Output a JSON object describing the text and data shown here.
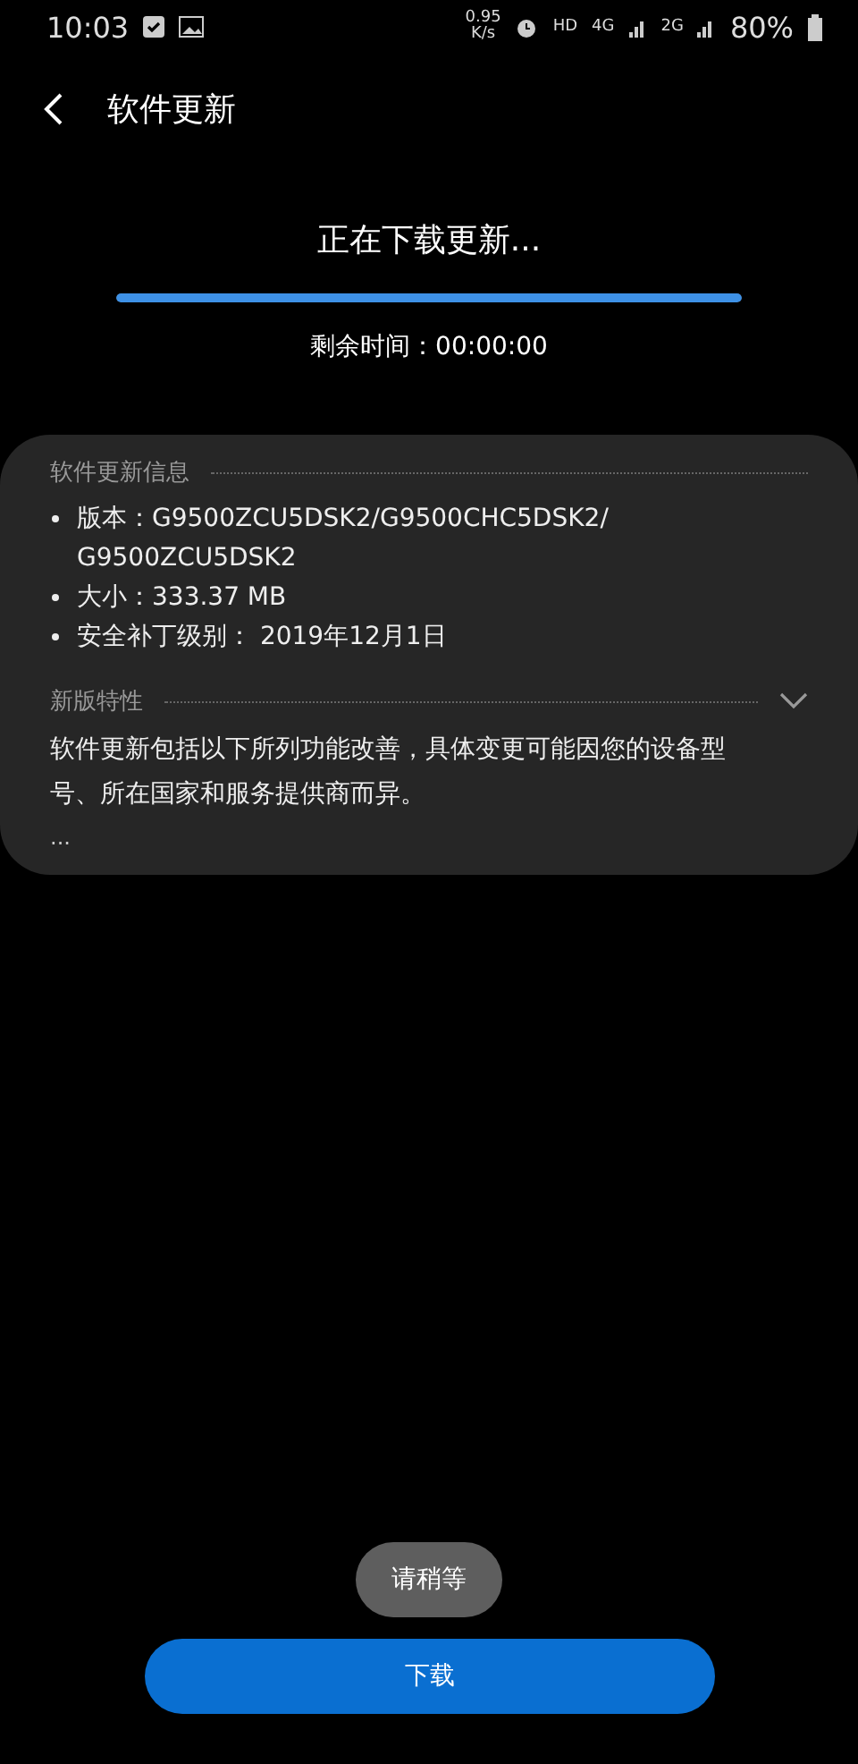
{
  "status_bar": {
    "time": "10:03",
    "speed": "0.95",
    "speed_unit": "K/s",
    "hd": "HD",
    "network": "4G",
    "network2": "2G",
    "battery": "80%"
  },
  "header": {
    "title": "软件更新"
  },
  "download": {
    "title": "正在下载更新...",
    "level": 1,
    "remaining": "剩余时间：00:00:00"
  },
  "info": {
    "heading": "软件更新信息",
    "items": [
      "版本：G9500ZCU5DSK2/G9500CHC5DSK2/\nG9500ZCU5DSK2",
      "大小：333.37 MB",
      "安全补丁级别： 2019年12月1日"
    ]
  },
  "features": {
    "heading": "新版特性",
    "expanded": false,
    "text": "软件更新包括以下所列功能改善，具体变更可能因您的设备型号、所在国家和服务提供商而异。",
    "more": "..."
  },
  "toast": "请稍等",
  "button": "下载"
}
